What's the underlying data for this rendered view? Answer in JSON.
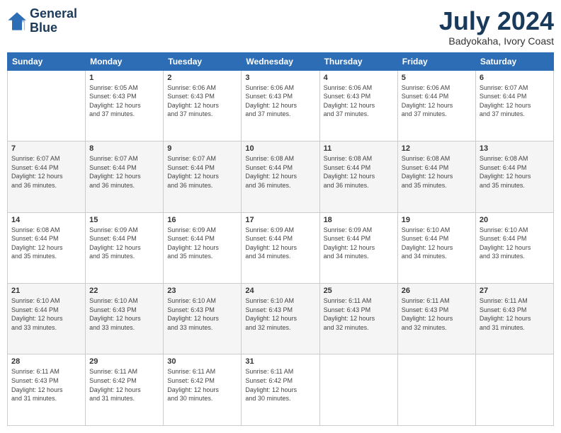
{
  "header": {
    "logo_line1": "General",
    "logo_line2": "Blue",
    "title": "July 2024",
    "subtitle": "Badyokaha, Ivory Coast"
  },
  "weekdays": [
    "Sunday",
    "Monday",
    "Tuesday",
    "Wednesday",
    "Thursday",
    "Friday",
    "Saturday"
  ],
  "weeks": [
    [
      {
        "day": "",
        "info": ""
      },
      {
        "day": "1",
        "info": "Sunrise: 6:05 AM\nSunset: 6:43 PM\nDaylight: 12 hours\nand 37 minutes."
      },
      {
        "day": "2",
        "info": "Sunrise: 6:06 AM\nSunset: 6:43 PM\nDaylight: 12 hours\nand 37 minutes."
      },
      {
        "day": "3",
        "info": "Sunrise: 6:06 AM\nSunset: 6:43 PM\nDaylight: 12 hours\nand 37 minutes."
      },
      {
        "day": "4",
        "info": "Sunrise: 6:06 AM\nSunset: 6:43 PM\nDaylight: 12 hours\nand 37 minutes."
      },
      {
        "day": "5",
        "info": "Sunrise: 6:06 AM\nSunset: 6:44 PM\nDaylight: 12 hours\nand 37 minutes."
      },
      {
        "day": "6",
        "info": "Sunrise: 6:07 AM\nSunset: 6:44 PM\nDaylight: 12 hours\nand 37 minutes."
      }
    ],
    [
      {
        "day": "7",
        "info": "Sunrise: 6:07 AM\nSunset: 6:44 PM\nDaylight: 12 hours\nand 36 minutes."
      },
      {
        "day": "8",
        "info": "Sunrise: 6:07 AM\nSunset: 6:44 PM\nDaylight: 12 hours\nand 36 minutes."
      },
      {
        "day": "9",
        "info": "Sunrise: 6:07 AM\nSunset: 6:44 PM\nDaylight: 12 hours\nand 36 minutes."
      },
      {
        "day": "10",
        "info": "Sunrise: 6:08 AM\nSunset: 6:44 PM\nDaylight: 12 hours\nand 36 minutes."
      },
      {
        "day": "11",
        "info": "Sunrise: 6:08 AM\nSunset: 6:44 PM\nDaylight: 12 hours\nand 36 minutes."
      },
      {
        "day": "12",
        "info": "Sunrise: 6:08 AM\nSunset: 6:44 PM\nDaylight: 12 hours\nand 35 minutes."
      },
      {
        "day": "13",
        "info": "Sunrise: 6:08 AM\nSunset: 6:44 PM\nDaylight: 12 hours\nand 35 minutes."
      }
    ],
    [
      {
        "day": "14",
        "info": "Sunrise: 6:08 AM\nSunset: 6:44 PM\nDaylight: 12 hours\nand 35 minutes."
      },
      {
        "day": "15",
        "info": "Sunrise: 6:09 AM\nSunset: 6:44 PM\nDaylight: 12 hours\nand 35 minutes."
      },
      {
        "day": "16",
        "info": "Sunrise: 6:09 AM\nSunset: 6:44 PM\nDaylight: 12 hours\nand 35 minutes."
      },
      {
        "day": "17",
        "info": "Sunrise: 6:09 AM\nSunset: 6:44 PM\nDaylight: 12 hours\nand 34 minutes."
      },
      {
        "day": "18",
        "info": "Sunrise: 6:09 AM\nSunset: 6:44 PM\nDaylight: 12 hours\nand 34 minutes."
      },
      {
        "day": "19",
        "info": "Sunrise: 6:10 AM\nSunset: 6:44 PM\nDaylight: 12 hours\nand 34 minutes."
      },
      {
        "day": "20",
        "info": "Sunrise: 6:10 AM\nSunset: 6:44 PM\nDaylight: 12 hours\nand 33 minutes."
      }
    ],
    [
      {
        "day": "21",
        "info": "Sunrise: 6:10 AM\nSunset: 6:44 PM\nDaylight: 12 hours\nand 33 minutes."
      },
      {
        "day": "22",
        "info": "Sunrise: 6:10 AM\nSunset: 6:43 PM\nDaylight: 12 hours\nand 33 minutes."
      },
      {
        "day": "23",
        "info": "Sunrise: 6:10 AM\nSunset: 6:43 PM\nDaylight: 12 hours\nand 33 minutes."
      },
      {
        "day": "24",
        "info": "Sunrise: 6:10 AM\nSunset: 6:43 PM\nDaylight: 12 hours\nand 32 minutes."
      },
      {
        "day": "25",
        "info": "Sunrise: 6:11 AM\nSunset: 6:43 PM\nDaylight: 12 hours\nand 32 minutes."
      },
      {
        "day": "26",
        "info": "Sunrise: 6:11 AM\nSunset: 6:43 PM\nDaylight: 12 hours\nand 32 minutes."
      },
      {
        "day": "27",
        "info": "Sunrise: 6:11 AM\nSunset: 6:43 PM\nDaylight: 12 hours\nand 31 minutes."
      }
    ],
    [
      {
        "day": "28",
        "info": "Sunrise: 6:11 AM\nSunset: 6:43 PM\nDaylight: 12 hours\nand 31 minutes."
      },
      {
        "day": "29",
        "info": "Sunrise: 6:11 AM\nSunset: 6:42 PM\nDaylight: 12 hours\nand 31 minutes."
      },
      {
        "day": "30",
        "info": "Sunrise: 6:11 AM\nSunset: 6:42 PM\nDaylight: 12 hours\nand 30 minutes."
      },
      {
        "day": "31",
        "info": "Sunrise: 6:11 AM\nSunset: 6:42 PM\nDaylight: 12 hours\nand 30 minutes."
      },
      {
        "day": "",
        "info": ""
      },
      {
        "day": "",
        "info": ""
      },
      {
        "day": "",
        "info": ""
      }
    ]
  ]
}
